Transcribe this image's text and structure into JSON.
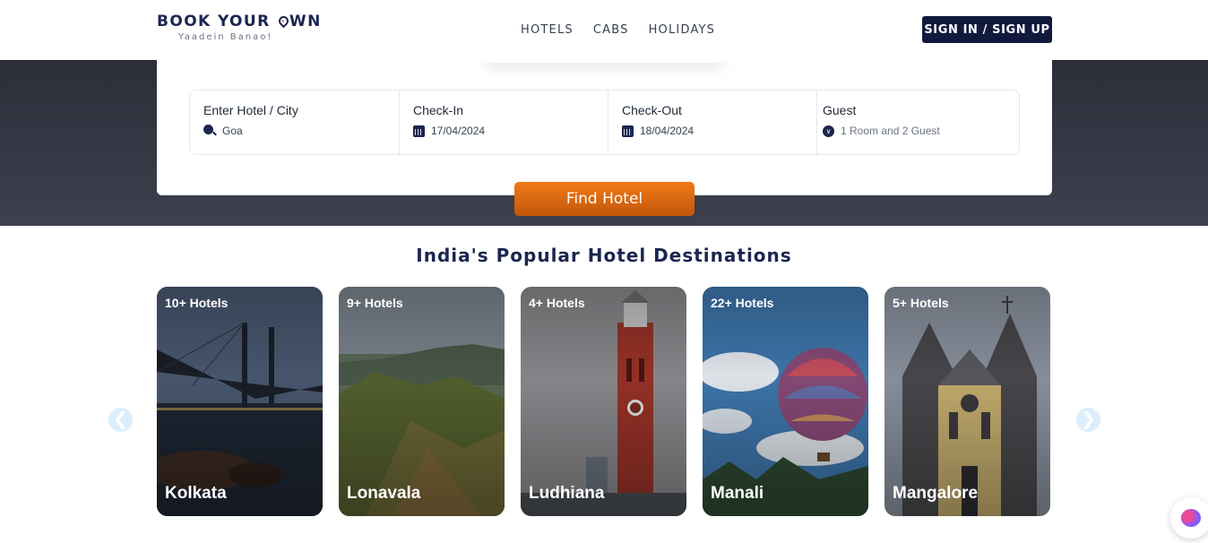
{
  "header": {
    "logo_part1": "BOOK YOUR ",
    "logo_part2": "WN",
    "tagline": "Yaadein Banao!",
    "nav": [
      "HOTELS",
      "CABS",
      "HOLIDAYS"
    ],
    "signin_label": "SIGN IN / SIGN UP"
  },
  "search": {
    "hotel_label": "Enter Hotel / City",
    "hotel_value": "Goa",
    "checkin_label": "Check-In",
    "checkin_value": "17/04/2024",
    "checkout_label": "Check-Out",
    "checkout_value": "18/04/2024",
    "guest_label": "Guest",
    "guest_value": "1 Room and 2 Guest",
    "find_label": "Find Hotel"
  },
  "destinations": {
    "title": "India's Popular Hotel Destinations",
    "cards": [
      {
        "count": "10+ Hotels",
        "city": "Kolkata"
      },
      {
        "count": "9+ Hotels",
        "city": "Lonavala"
      },
      {
        "count": "4+ Hotels",
        "city": "Ludhiana"
      },
      {
        "count": "22+ Hotels",
        "city": "Manali"
      },
      {
        "count": "5+ Hotels",
        "city": "Mangalore"
      }
    ],
    "prev_glyph": "❮",
    "next_glyph": "❯"
  },
  "colors": {
    "brand_navy": "#1b2550",
    "accent_orange": "#f07a16",
    "hero_dark": "#2c2e3a"
  },
  "icons": [
    "search-icon",
    "calendar-icon",
    "chevron-down-icon",
    "assistant-icon"
  ]
}
